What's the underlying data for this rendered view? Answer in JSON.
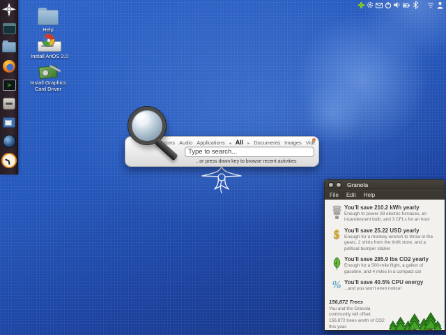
{
  "tray": {
    "icons": [
      "software-update-icon",
      "gear-icon",
      "mail-icon",
      "power-icon",
      "volume-icon",
      "battery-icon",
      "bluetooth-icon",
      "network-signal-icon",
      "user-icon"
    ]
  },
  "dock": {
    "items": [
      "arios-launcher-icon",
      "terminal-icon",
      "file-manager-icon",
      "firefox-icon",
      "run-prompt-icon",
      "software-center-icon",
      "media-player-icon",
      "web-globe-icon",
      "clock-icon"
    ],
    "prompt_glyph": ">"
  },
  "desktop_icons": [
    {
      "label": "Help"
    },
    {
      "label": "Install AriOS 2.0"
    },
    {
      "label": "Install Graphics Card Driver"
    }
  ],
  "search": {
    "categories": [
      "Actions",
      "Audio",
      "Applications",
      "All",
      "Documents",
      "Images",
      "Videos"
    ],
    "active_category": "All",
    "prev_arrow": "◂",
    "next_arrow": "▸",
    "placeholder": "Type to search...",
    "hint": "...or press down key to browse recent activities"
  },
  "granola": {
    "title": "Granola",
    "menus": [
      "File",
      "Edit",
      "Help"
    ],
    "dollar_glyph": "$",
    "percent_glyph": "%",
    "rows": [
      {
        "icon": "cfl-bulb-icon",
        "title": "You'll save 210.2 kWh yearly",
        "desc": "Enough to power 28 electric furnaces, an incandescent bulb, and 3 CFLs for an hour"
      },
      {
        "icon": "dollar-icon",
        "title": "You'll save 25.22 USD yearly",
        "desc": "Enough for a monkey wrench to throw in the gears, 2 shirts from the thrift store, and a political bumper sticker"
      },
      {
        "icon": "leaf-icon",
        "title": "You'll save 285.9 lbs CO2 yearly",
        "desc": "Enough for a 500-mile flight, a gallon of gasoline, and 4 miles in a compact car"
      },
      {
        "icon": "percent-icon",
        "title": "You'll save 40.5% CPU energy",
        "desc": "...and you won't even notice!"
      }
    ],
    "trees": {
      "title": "156,872 Trees",
      "desc": "You and the Granola community will offset 156,872 trees worth of CO2 this year."
    }
  },
  "colors": {
    "desktop_blue": "#2457bb",
    "dock_bg": "#2a1f26",
    "titlebar": "#3b3832",
    "window_body": "#f2f1ee",
    "accent_green": "#7dc32e"
  }
}
